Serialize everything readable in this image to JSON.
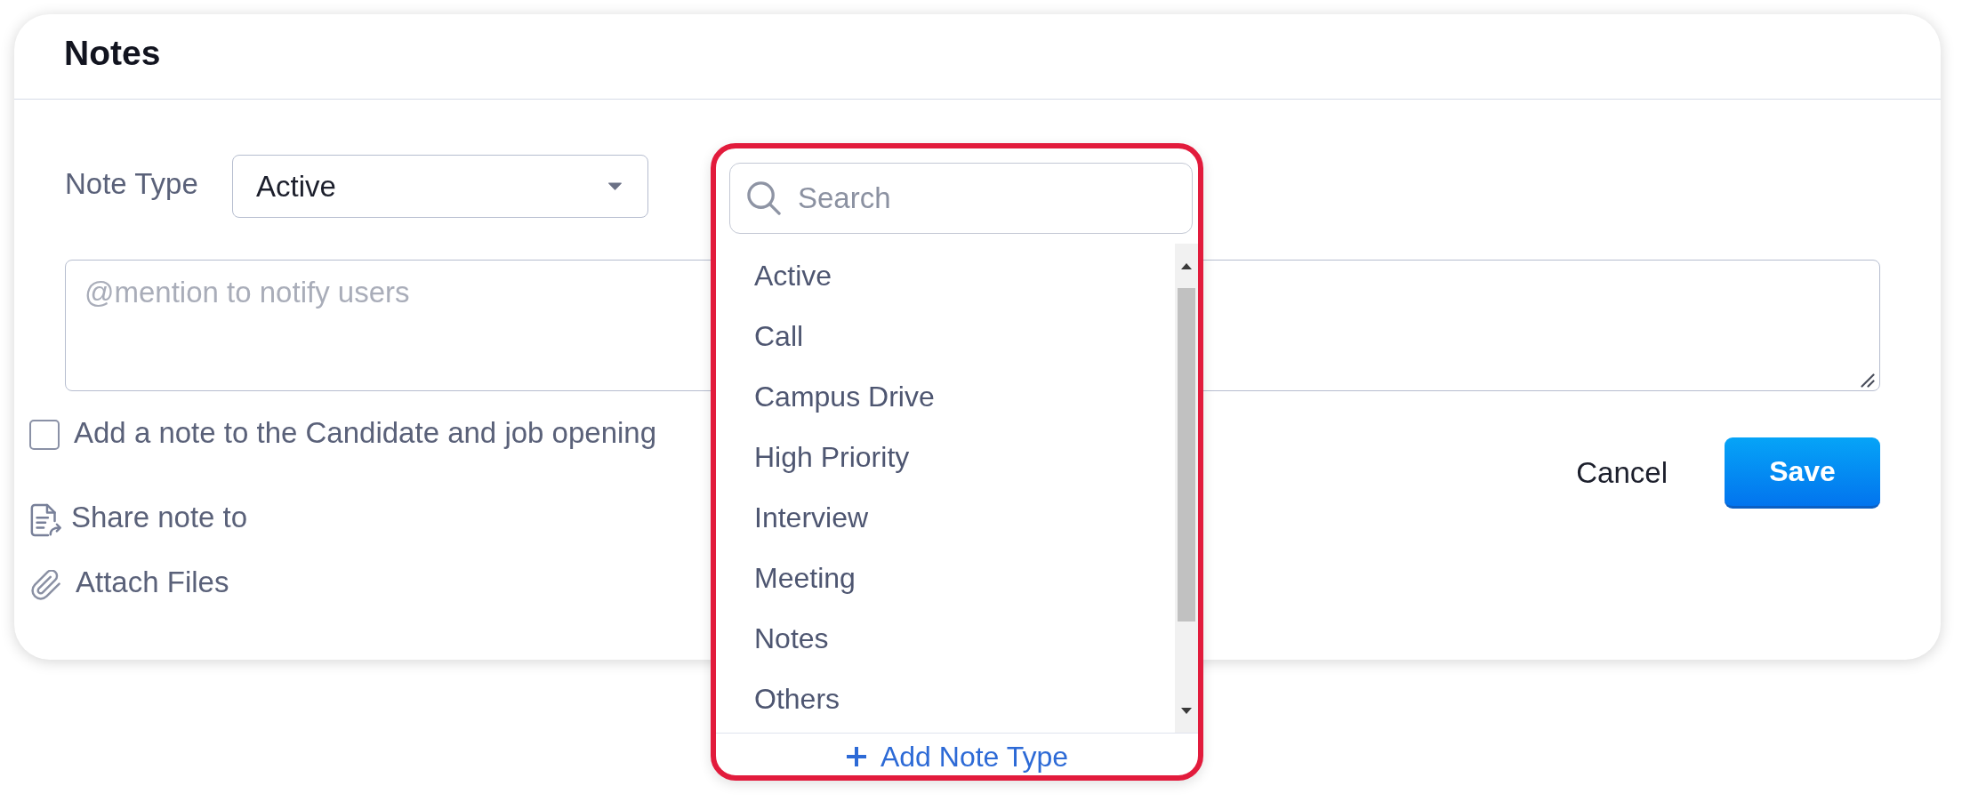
{
  "panel": {
    "title": "Notes"
  },
  "note_type": {
    "label": "Note Type",
    "value": "Active",
    "expanded": true,
    "dropdown": {
      "search": {
        "placeholder": "Search"
      },
      "options": [
        {
          "label": "Active",
          "selected": false
        },
        {
          "label": "Call",
          "selected": false
        },
        {
          "label": "Campus Drive",
          "selected": false
        },
        {
          "label": "High Priority",
          "selected": false
        },
        {
          "label": "Interview",
          "selected": false
        },
        {
          "label": "Meeting",
          "selected": false
        },
        {
          "label": "Notes",
          "selected": false
        },
        {
          "label": "Others",
          "selected": false
        }
      ],
      "add_label": "Add Note Type"
    }
  },
  "editor": {
    "placeholder": "@mention to notify users"
  },
  "candidate_option": {
    "label": "Add a note to the Candidate and job opening",
    "checked": false
  },
  "actions": [
    {
      "kind": "share",
      "label": "Share note to"
    },
    {
      "kind": "attach",
      "label": "Attach Files"
    }
  ],
  "buttons": [
    {
      "kind": "secondary",
      "label": "Cancel"
    },
    {
      "kind": "primary",
      "label": "Save"
    }
  ]
}
